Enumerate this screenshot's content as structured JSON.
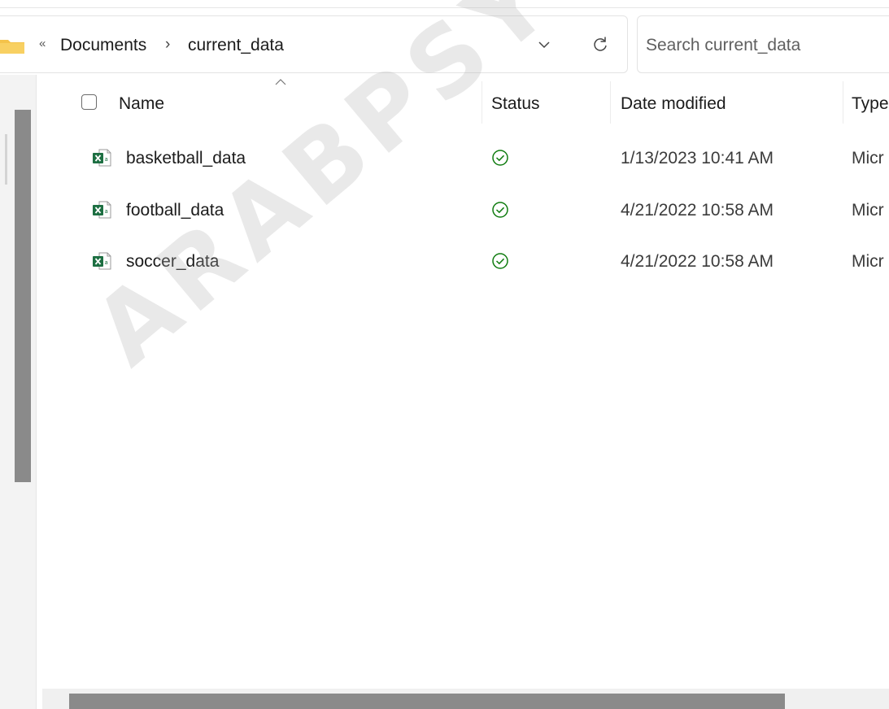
{
  "address_bar": {
    "overflow": "«",
    "breadcrumb": [
      "Documents",
      "current_data"
    ],
    "separator": "›"
  },
  "search": {
    "placeholder": "Search current_data"
  },
  "columns": {
    "name": "Name",
    "status": "Status",
    "date_modified": "Date modified",
    "type": "Type"
  },
  "files": [
    {
      "name": "basketball_data",
      "date": "1/13/2023 10:41 AM",
      "type": "Micr",
      "status": "available"
    },
    {
      "name": "football_data",
      "date": "4/21/2022 10:58 AM",
      "type": "Micr",
      "status": "available"
    },
    {
      "name": "soccer_data",
      "date": "4/21/2022 10:58 AM",
      "type": "Micr",
      "status": "available"
    }
  ],
  "watermark": "ARABPSYCHOLOGY",
  "colors": {
    "excel_green": "#1d6f42",
    "status_green": "#107c10",
    "folder_yellow": "#f4c34a"
  },
  "icons": {
    "folder": "folder-icon",
    "history": "chevron-down-icon",
    "refresh": "refresh-icon",
    "sort": "sort-ascending-icon",
    "file": "excel-file-icon",
    "status": "check-circle-icon"
  }
}
